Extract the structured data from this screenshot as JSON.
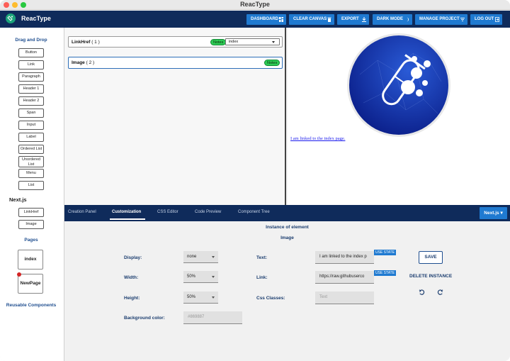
{
  "window": {
    "title": "ReacType"
  },
  "appbar": {
    "name": "ReacType",
    "buttons": [
      {
        "label": "DASHBOARD",
        "icon": "dashboard-icon"
      },
      {
        "label": "CLEAR CANVAS",
        "icon": "trash-icon"
      },
      {
        "label": "EXPORT",
        "icon": "download-icon"
      },
      {
        "label": "DARK MODE",
        "icon": "moon-icon"
      },
      {
        "label": "MANAGE PROJECT",
        "icon": "menu-icon"
      },
      {
        "label": "LOG OUT",
        "icon": "logout-icon"
      }
    ]
  },
  "sidebar": {
    "drag_heading": "Drag and Drop",
    "html_elements": [
      "Button",
      "Link",
      "Paragraph",
      "Header 1",
      "Header 2",
      "Span",
      "Input",
      "Label",
      "Ordered List",
      "Unordered List",
      "Menu",
      "List"
    ],
    "next_heading": "Next.js",
    "next_elements": [
      "LinkHref",
      "Image"
    ],
    "pages_heading": "Pages",
    "pages": [
      "index",
      "NewPage"
    ],
    "reusable_heading": "Reusable Components"
  },
  "tree": {
    "rows": [
      {
        "name": "LinkHref",
        "count": "( 1 )",
        "notes": "Notes",
        "select_value": "index"
      },
      {
        "name": "Image",
        "count": "( 2 )",
        "notes": "Notes"
      }
    ]
  },
  "preview": {
    "link_text": "I am linked to the index page."
  },
  "bottom_tabs": {
    "tabs": [
      "Creation Panel",
      "Customization",
      "CSS Editor",
      "Code Preview",
      "Component Tree"
    ],
    "active": "Customization",
    "framework": "Next.js"
  },
  "customization": {
    "title": "Instance of element",
    "element": "Image",
    "display_label": "Display:",
    "display_value": "none",
    "width_label": "Width:",
    "width_value": "50%",
    "height_label": "Height:",
    "height_value": "50%",
    "bg_label": "Background color:",
    "bg_value": "#869887",
    "text_label": "Text:",
    "text_value": "I am linked to the index p",
    "link_label": "Link:",
    "link_value": "https://raw.githubuserco",
    "css_label": "Css Classes:",
    "css_placeholder": "Text",
    "use_state": "USE STATE",
    "save": "SAVE",
    "delete": "DELETE INSTANCE"
  },
  "colors": {
    "navy": "#0f2b5b",
    "accent": "#1f7ad1",
    "notes_green": "#2ecc55"
  }
}
